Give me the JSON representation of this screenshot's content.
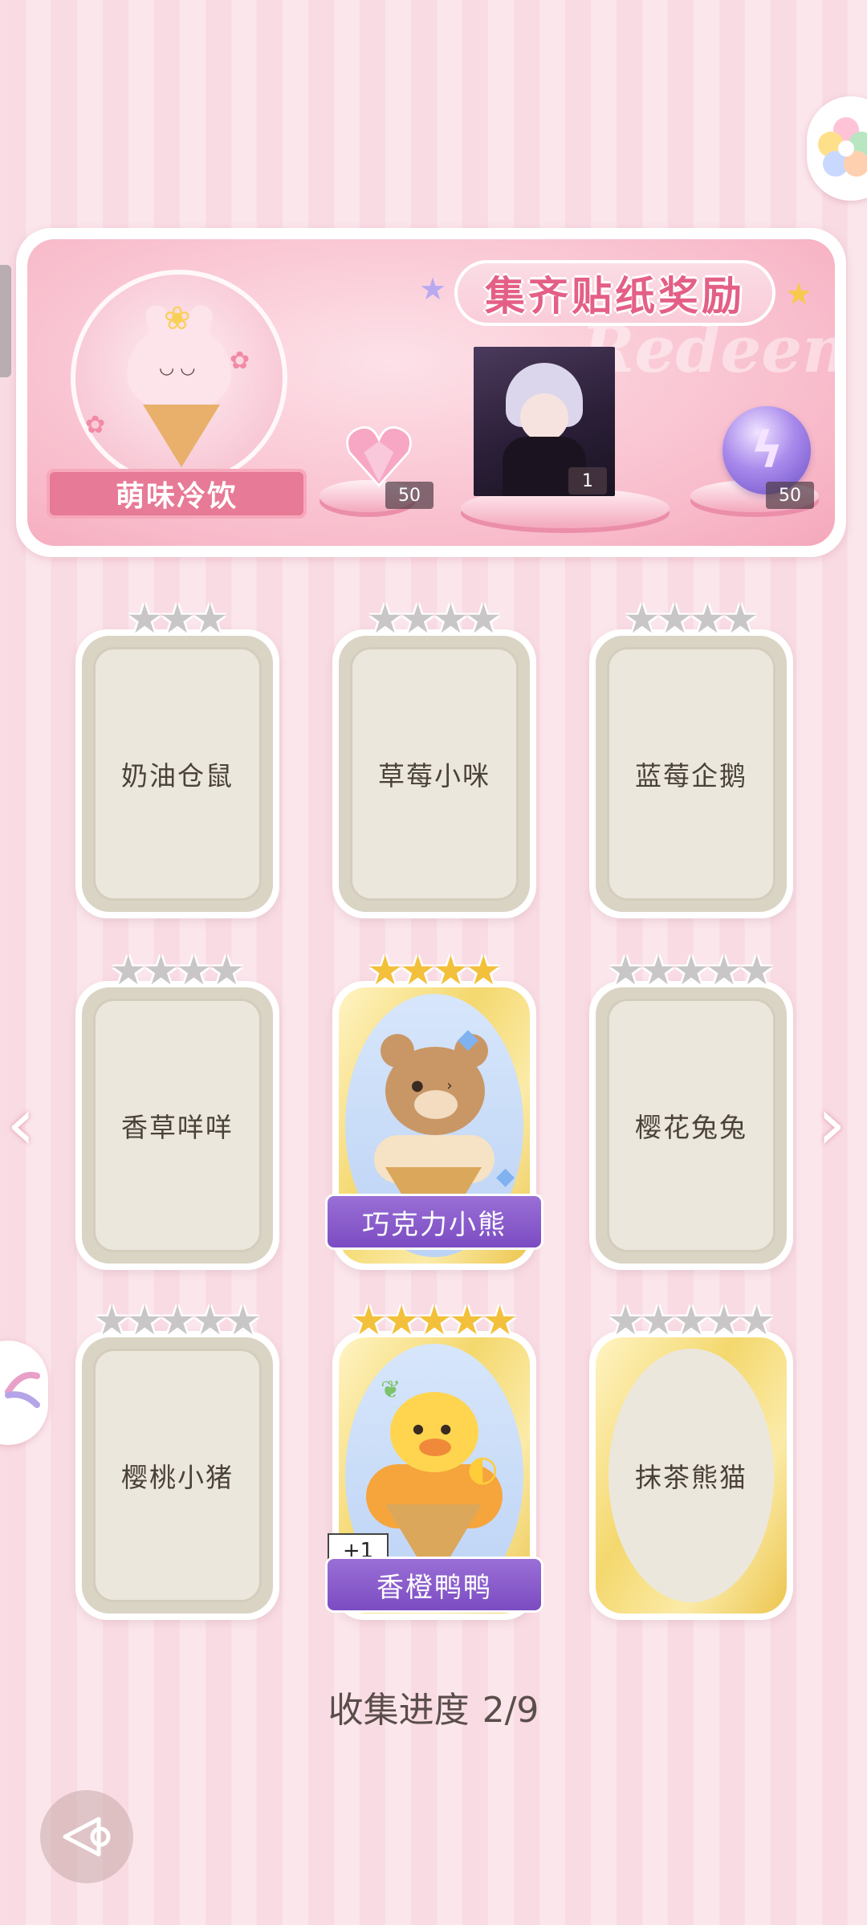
{
  "banner": {
    "title": "集齐贴纸奖励",
    "watermark": "Redeem",
    "theme_label": "萌味冷饮",
    "rewards": [
      {
        "icon": "pink-diamond-heart-icon",
        "count": "50"
      },
      {
        "icon": "character-portrait",
        "count": "1"
      },
      {
        "icon": "purple-energy-orb-icon",
        "count": "50"
      }
    ]
  },
  "cards": [
    {
      "name": "奶油仓鼠",
      "stars": 3,
      "star_color": "grey",
      "state": "locked"
    },
    {
      "name": "草莓小咪",
      "stars": 4,
      "star_color": "grey",
      "state": "locked"
    },
    {
      "name": "蓝莓企鹅",
      "stars": 4,
      "star_color": "grey",
      "state": "locked"
    },
    {
      "name": "香草咩咩",
      "stars": 4,
      "star_color": "grey",
      "state": "locked"
    },
    {
      "name": "巧克力小熊",
      "stars": 4,
      "star_color": "gold",
      "state": "collected"
    },
    {
      "name": "樱花兔兔",
      "stars": 5,
      "star_color": "grey",
      "state": "locked"
    },
    {
      "name": "樱桃小猪",
      "stars": 5,
      "star_color": "grey",
      "state": "locked"
    },
    {
      "name": "香橙鸭鸭",
      "stars": 5,
      "star_color": "gold",
      "state": "collected",
      "badge": "+1"
    },
    {
      "name": "抹茶熊猫",
      "stars": 5,
      "star_color": "grey",
      "state": "locked-gold-frame"
    }
  ],
  "progress": {
    "label": "收集进度",
    "value": "2/9"
  },
  "icons": {
    "back": "back-arrow-icon",
    "prev": "chevron-left-icon",
    "next": "chevron-right-icon",
    "flower": "flower-icon"
  },
  "colors": {
    "accent": "#e45f86",
    "label_purple": "#8a5bcc",
    "gold": "#f3c03c"
  }
}
